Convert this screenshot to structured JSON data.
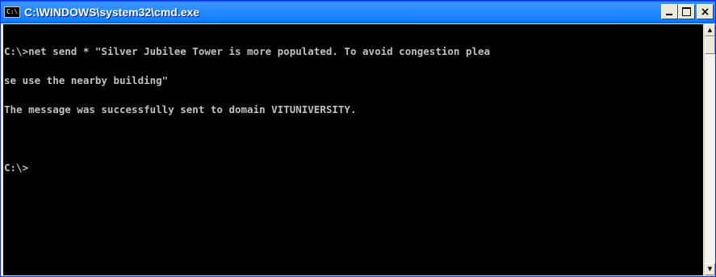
{
  "window": {
    "title": "C:\\WINDOWS\\system32\\cmd.exe",
    "icon": "cmd-icon",
    "icon_text": "C:\\",
    "controls": {
      "minimize": "minimize-icon",
      "maximize": "maximize-icon",
      "close_glyph": "×"
    }
  },
  "console": {
    "lines": [
      "C:\\>net send * \"Silver Jubilee Tower is more populated. To avoid congestion plea",
      "se use the nearby building\"",
      "The message was successfully sent to domain VITUNIVERSITY.",
      "",
      "C:\\>"
    ],
    "background_color": "#000000",
    "text_color": "#c0c0c0"
  },
  "scrollbar": {
    "up_glyph": "▲",
    "down_glyph": "▼",
    "position": 0
  }
}
